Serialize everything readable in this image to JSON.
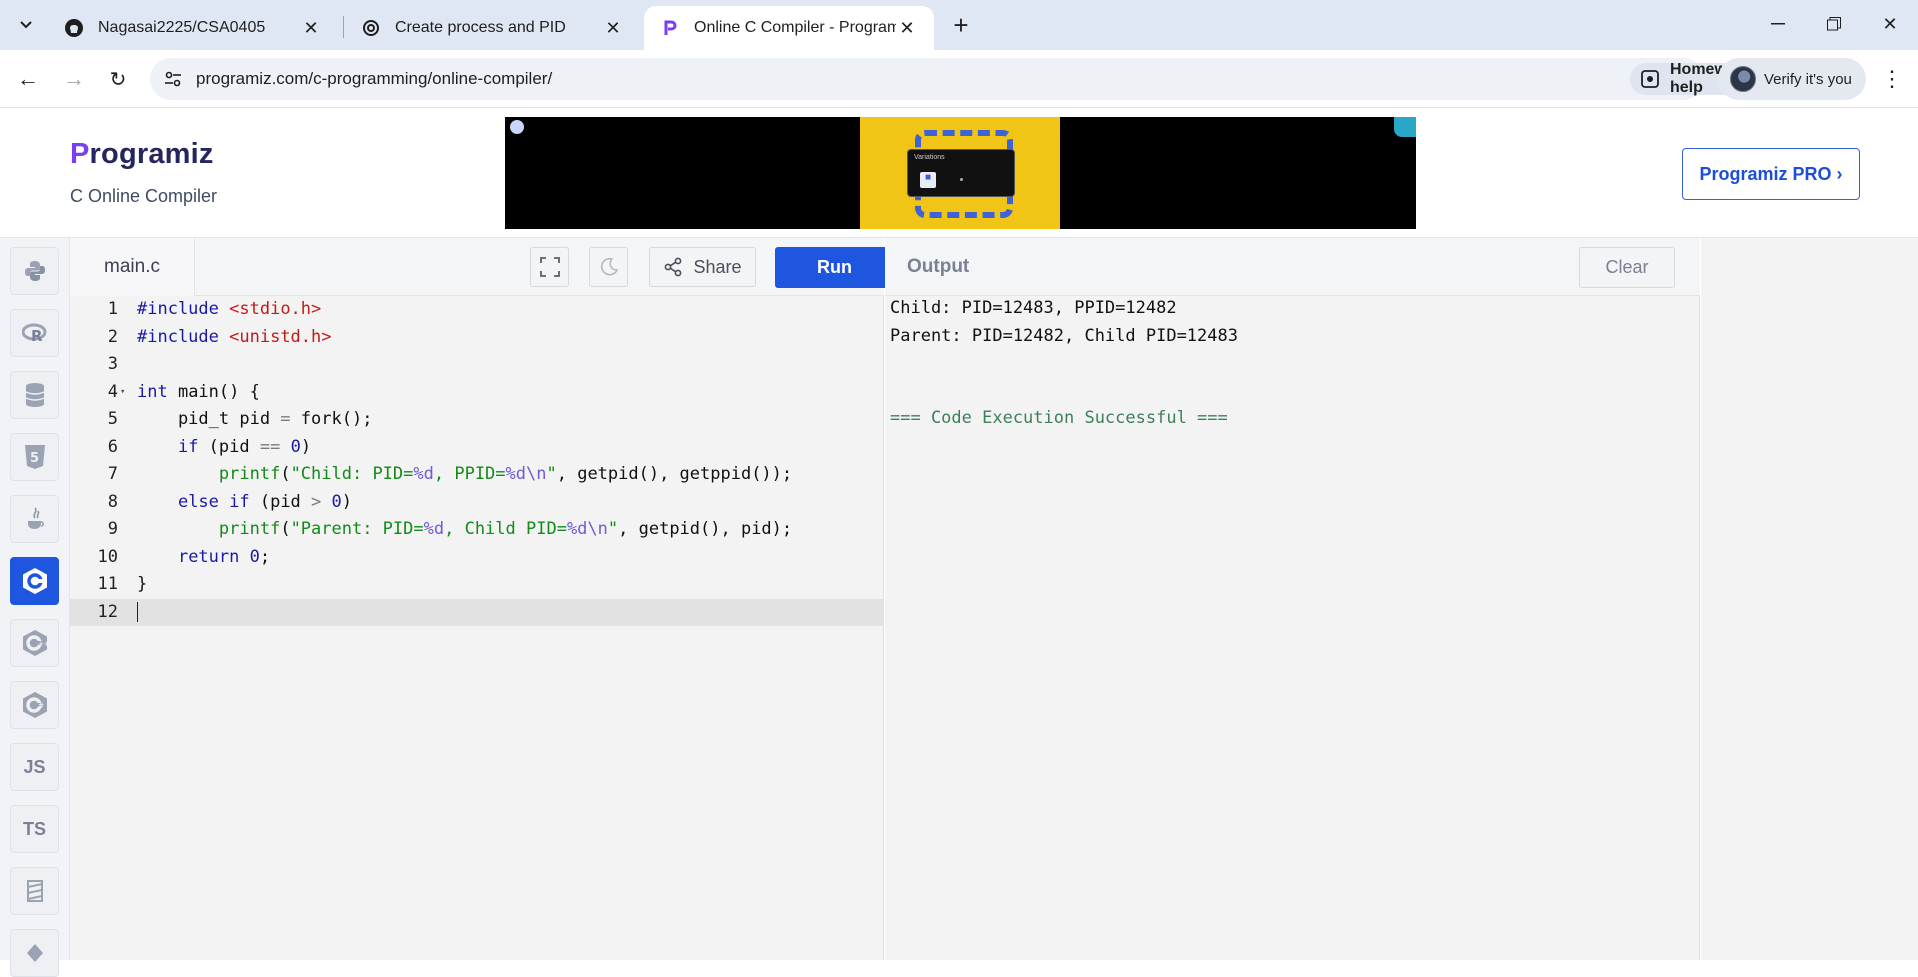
{
  "browser": {
    "tabs": [
      {
        "title": "Nagasai2225/CSA0405",
        "icon": "github-icon"
      },
      {
        "title": "Create process and PID",
        "icon": "openai-icon"
      },
      {
        "title": "Online C Compiler - Programiz",
        "icon": "programiz-icon",
        "active": true
      }
    ],
    "url": "programiz.com/c-programming/online-compiler/",
    "homework_chip": "Homework help",
    "verify_label": "Verify it's you"
  },
  "site": {
    "logo_p": "P",
    "logo_rest": "rogramiz",
    "subtitle": "C Online Compiler",
    "pro_button": "Programiz PRO ›",
    "ad_caption": "Variations"
  },
  "rail": {
    "items": [
      "python-icon",
      "r-icon",
      "sql-icon",
      "html5-icon",
      "java-icon",
      "c-icon",
      "cpp-icon",
      "csharp-icon",
      "JS",
      "TS",
      "swift-icon",
      "go-icon"
    ],
    "active": "c-icon"
  },
  "editor": {
    "filename": "main.c",
    "share_label": "Share",
    "run_label": "Run",
    "line_numbers": [
      "1",
      "2",
      "3",
      "4",
      "5",
      "6",
      "7",
      "8",
      "9",
      "10",
      "11",
      "12"
    ]
  },
  "output": {
    "title": "Output",
    "clear_label": "Clear",
    "lines": [
      "Child: PID=12483, PPID=12482",
      "Parent: PID=12482, Child PID=12483",
      "",
      "",
      "=== Code Execution Successful ==="
    ]
  },
  "colors": {
    "accent": "#1f56e0",
    "logo_purple": "#7b3ef0",
    "success": "#3d7f5c"
  }
}
